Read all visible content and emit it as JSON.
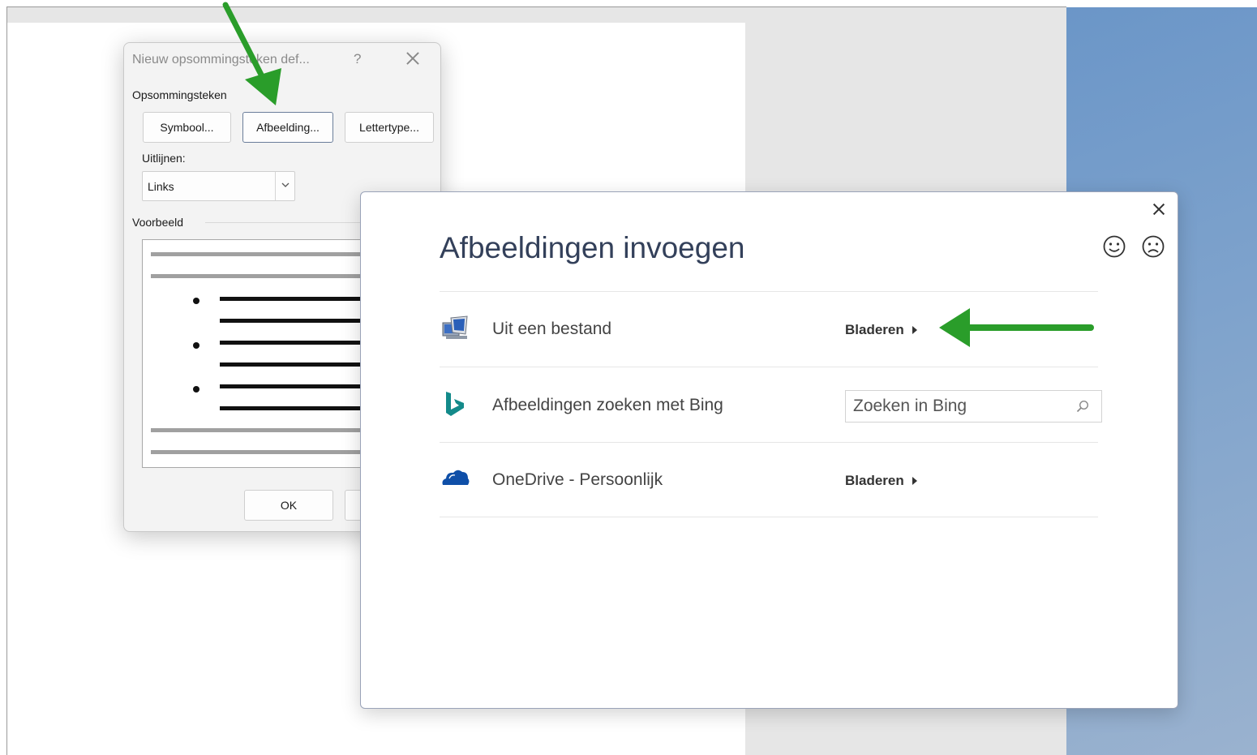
{
  "bullet_dialog": {
    "title": "Nieuw opsommingsteken def...",
    "help": "?",
    "group_label": "Opsommingsteken",
    "buttons": {
      "symbol": "Symbool...",
      "picture": "Afbeelding...",
      "font": "Lettertype..."
    },
    "align_label": "Uitlijnen:",
    "align_value": "Links",
    "preview_label": "Voorbeeld",
    "ok": "OK"
  },
  "insert_dialog": {
    "title": "Afbeeldingen invoegen",
    "feedback": {
      "smile": "smile-icon",
      "frown": "frown-icon"
    },
    "rows": [
      {
        "label": "Uit een bestand",
        "action": "Bladeren",
        "icon": "computer-icon"
      },
      {
        "label": "Afbeeldingen zoeken met Bing",
        "placeholder": "Zoeken in Bing",
        "icon": "bing-icon"
      },
      {
        "label": "OneDrive - Persoonlijk",
        "action": "Bladeren",
        "icon": "onedrive-icon"
      }
    ]
  },
  "colors": {
    "annotation_arrow": "#2a9d2a",
    "title_text": "#33405a",
    "bing_teal": "#138a8a",
    "onedrive_blue": "#0f4fa8"
  }
}
